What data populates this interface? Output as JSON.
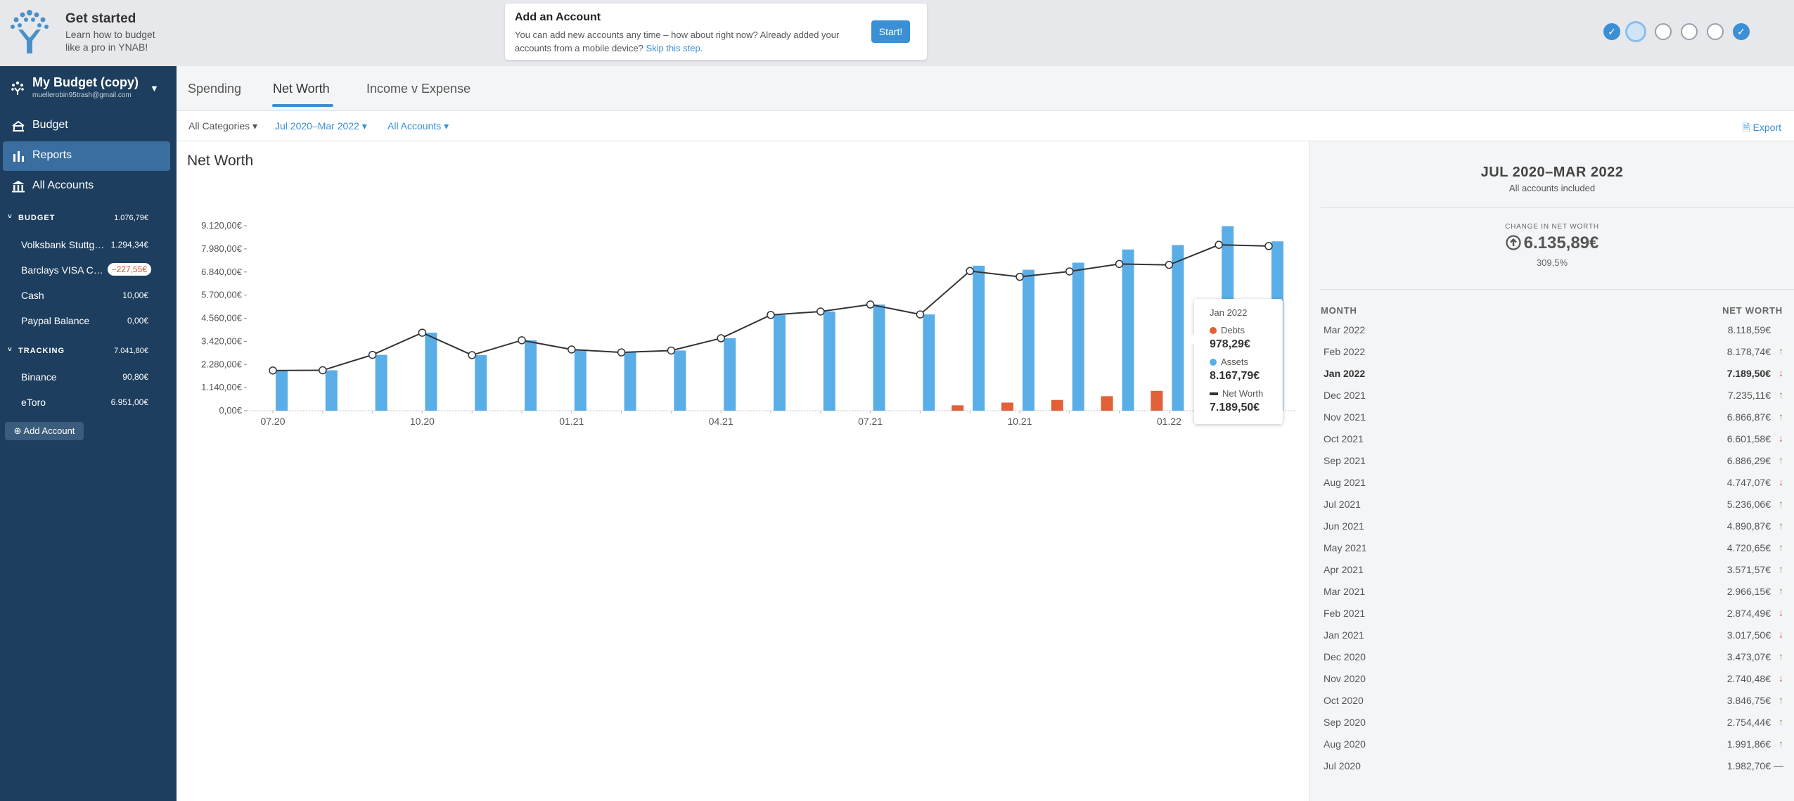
{
  "onboarding": {
    "title": "Get started",
    "subtitle_line1": "Learn how to budget",
    "subtitle_line2": "like a pro in YNAB!",
    "card_title": "Add an Account",
    "card_text": "You can add new accounts any time – how about right now? Already added your accounts from a mobile device?",
    "card_link": "Skip this step.",
    "start_label": "Start!",
    "steps": [
      {
        "state": "done",
        "glyph": "✓"
      },
      {
        "state": "current",
        "glyph": ""
      },
      {
        "state": "todo",
        "glyph": ""
      },
      {
        "state": "todo",
        "glyph": ""
      },
      {
        "state": "todo",
        "glyph": ""
      },
      {
        "state": "done",
        "glyph": "✓"
      }
    ]
  },
  "sidebar": {
    "budget_name": "My Budget (copy)",
    "budget_email": "muellerobin95trash@gmail.com",
    "caret": "▼",
    "nav": [
      {
        "label": "Budget",
        "icon": "budget-icon"
      },
      {
        "label": "Reports",
        "icon": "reports-icon"
      },
      {
        "label": "All Accounts",
        "icon": "bank-icon"
      }
    ],
    "groups": [
      {
        "name": "BUDGET",
        "amount": "1.076,79€",
        "accounts": [
          {
            "name": "Volksbank Stuttgart",
            "amount": "1.294,34€",
            "negative": false
          },
          {
            "name": "Barclays VISA Credit",
            "amount": "−227,55€",
            "negative": true
          },
          {
            "name": "Cash",
            "amount": "10,00€",
            "negative": false
          },
          {
            "name": "Paypal Balance",
            "amount": "0,00€",
            "negative": false
          }
        ]
      },
      {
        "name": "TRACKING",
        "amount": "7.041,80€",
        "accounts": [
          {
            "name": "Binance",
            "amount": "90,80€",
            "negative": false
          },
          {
            "name": "eToro",
            "amount": "6.951,00€",
            "negative": false
          }
        ]
      }
    ],
    "add_account": "Add Account"
  },
  "tabs": {
    "spending": "Spending",
    "net_worth": "Net Worth",
    "income_expense": "Income v Expense"
  },
  "filters": {
    "categories": "All Categories ▾",
    "range": "Jul 2020–Mar 2022 ▾",
    "accounts": "All Accounts ▾",
    "export": "Export"
  },
  "chart_title": "Net Worth",
  "colors": {
    "assets": "#5aaee8",
    "debts": "#e0603a",
    "net_worth_line": "#333333",
    "accent": "#3b8fd4",
    "sidebar_bg": "#1d3e5e"
  },
  "chart_data": {
    "type": "bar",
    "months": [
      "07.20",
      "08.20",
      "09.20",
      "10.20",
      "11.20",
      "12.20",
      "01.21",
      "02.21",
      "03.21",
      "04.21",
      "05.21",
      "06.21",
      "07.21",
      "08.21",
      "09.21",
      "10.21",
      "11.21",
      "12.21",
      "01.22",
      "02.22",
      "03.22"
    ],
    "x_tick_labels": [
      "07.20",
      "10.20",
      "01.21",
      "04.21",
      "07.21",
      "10.21",
      "01.22"
    ],
    "y_ticks": [
      "0,00€",
      "1.140,00€",
      "2.280,00€",
      "3.420,00€",
      "4.560,00€",
      "5.700,00€",
      "6.840,00€",
      "7.980,00€",
      "9.120,00€"
    ],
    "ylim": [
      0,
      9120
    ],
    "series": [
      {
        "name": "Assets",
        "values": [
          1983,
          1992,
          2754,
          3847,
          2740,
          3473,
          3018,
          2874,
          2966,
          3572,
          4721,
          4891,
          5236,
          4747,
          7150,
          6950,
          7300,
          7950,
          8168,
          9100,
          8350
        ]
      },
      {
        "name": "Debts",
        "values": [
          0,
          0,
          0,
          0,
          0,
          0,
          0,
          0,
          0,
          0,
          0,
          0,
          0,
          0,
          265,
          400,
          530,
          715,
          978,
          0,
          0
        ]
      },
      {
        "name": "Net Worth",
        "values": [
          1982.7,
          1991.86,
          2754.44,
          3846.75,
          2740.48,
          3473.07,
          3017.5,
          2874.49,
          2966.15,
          3571.57,
          4720.65,
          4890.87,
          5236.06,
          4747.07,
          6886.29,
          6601.58,
          6866.87,
          7235.11,
          7189.5,
          8178.74,
          8118.59
        ]
      }
    ]
  },
  "tooltip": {
    "month": "Jan 2022",
    "debts_label": "Debts",
    "debts_value": "978,29€",
    "assets_label": "Assets",
    "assets_value": "8.167,79€",
    "nw_label": "Net Worth",
    "nw_value": "7.189,50€"
  },
  "panel": {
    "range": "JUL 2020–MAR 2022",
    "subtitle": "All accounts included",
    "change_label": "CHANGE IN NET WORTH",
    "change_value": "6.135,89€",
    "change_pct": "309,5%",
    "col_month": "MONTH",
    "col_nw": "NET WORTH",
    "rows": [
      {
        "month": "Mar 2022",
        "value": "8.118,59€",
        "trend": "none",
        "bold": false
      },
      {
        "month": "Feb 2022",
        "value": "8.178,74€",
        "trend": "up",
        "bold": false
      },
      {
        "month": "Jan 2022",
        "value": "7.189,50€",
        "trend": "down",
        "bold": true
      },
      {
        "month": "Dec 2021",
        "value": "7.235,11€",
        "trend": "up",
        "bold": false
      },
      {
        "month": "Nov 2021",
        "value": "6.866,87€",
        "trend": "up",
        "bold": false
      },
      {
        "month": "Oct 2021",
        "value": "6.601,58€",
        "trend": "down",
        "bold": false
      },
      {
        "month": "Sep 2021",
        "value": "6.886,29€",
        "trend": "up",
        "bold": false
      },
      {
        "month": "Aug 2021",
        "value": "4.747,07€",
        "trend": "down",
        "bold": false
      },
      {
        "month": "Jul 2021",
        "value": "5.236,06€",
        "trend": "up",
        "bold": false
      },
      {
        "month": "Jun 2021",
        "value": "4.890,87€",
        "trend": "up",
        "bold": false
      },
      {
        "month": "May 2021",
        "value": "4.720,65€",
        "trend": "up",
        "bold": false
      },
      {
        "month": "Apr 2021",
        "value": "3.571,57€",
        "trend": "up",
        "bold": false
      },
      {
        "month": "Mar 2021",
        "value": "2.966,15€",
        "trend": "up",
        "bold": false
      },
      {
        "month": "Feb 2021",
        "value": "2.874,49€",
        "trend": "down",
        "bold": false
      },
      {
        "month": "Jan 2021",
        "value": "3.017,50€",
        "trend": "down",
        "bold": false
      },
      {
        "month": "Dec 2020",
        "value": "3.473,07€",
        "trend": "up",
        "bold": false
      },
      {
        "month": "Nov 2020",
        "value": "2.740,48€",
        "trend": "down",
        "bold": false
      },
      {
        "month": "Oct 2020",
        "value": "3.846,75€",
        "trend": "up",
        "bold": false
      },
      {
        "month": "Sep 2020",
        "value": "2.754,44€",
        "trend": "up",
        "bold": false
      },
      {
        "month": "Aug 2020",
        "value": "1.991,86€",
        "trend": "up",
        "bold": false
      },
      {
        "month": "Jul 2020",
        "value": "1.982,70€",
        "trend": "flat",
        "bold": false
      }
    ]
  }
}
